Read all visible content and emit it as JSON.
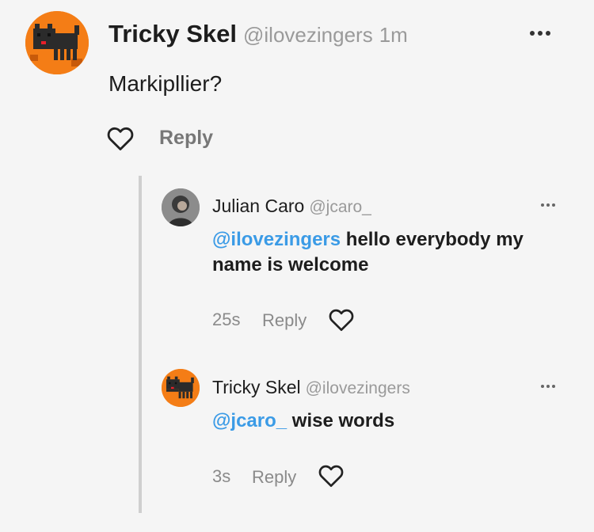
{
  "main_comment": {
    "author": "Tricky Skel",
    "handle": "@ilovezingers",
    "time": "1m",
    "text": "Markipllier?",
    "reply_label": "Reply"
  },
  "replies": [
    {
      "author": "Julian Caro",
      "handle": "@jcaro_",
      "mention": "@ilovezingers",
      "text": " hello everybody my name is welcome",
      "time": "25s",
      "reply_label": "Reply"
    },
    {
      "author": "Tricky Skel",
      "handle": "@ilovezingers",
      "mention": "@jcaro_",
      "text": " wise words",
      "time": "3s",
      "reply_label": "Reply"
    }
  ],
  "colors": {
    "mention": "#3b9be6",
    "avatar_orange": "#f47d16",
    "background": "#f5f5f5"
  }
}
